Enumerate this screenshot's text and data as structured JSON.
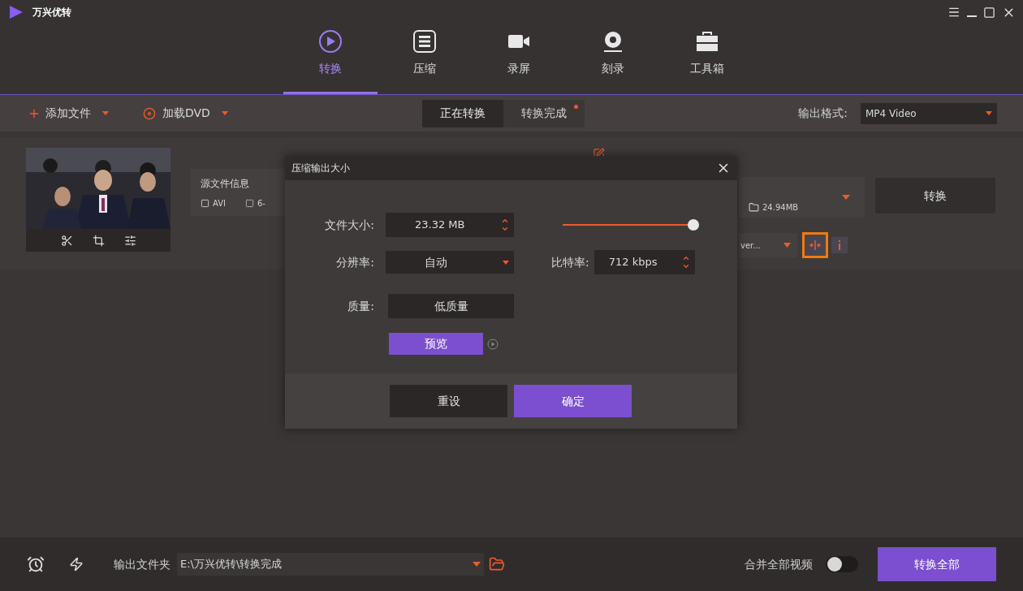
{
  "app": {
    "title": "万兴优转"
  },
  "nav_tabs": [
    {
      "label": "转换",
      "selected": true
    },
    {
      "label": "压缩",
      "selected": false
    },
    {
      "label": "录屏",
      "selected": false
    },
    {
      "label": "刻录",
      "selected": false
    },
    {
      "label": "工具箱",
      "selected": false
    }
  ],
  "toolbar": {
    "add_file": "添加文件",
    "load_dvd": "加载DVD",
    "status_tabs": [
      {
        "label": "正在转换",
        "selected": true,
        "notification": false
      },
      {
        "label": "转换完成",
        "selected": false,
        "notification": true
      }
    ],
    "output_format": {
      "label": "输出格式:",
      "value": "MP4 Video"
    }
  },
  "file": {
    "source_info_label": "源文件信息",
    "format": "AVI",
    "resolution": "6-",
    "target_size": "24.94MB",
    "preset": "ver...",
    "compress_highlighted": true,
    "convert": "转换"
  },
  "dialog": {
    "title": "压缩输出大小",
    "file_size": {
      "label": "文件大小:",
      "value": "23.32 MB"
    },
    "size_slider": {
      "level": 1.0
    },
    "resolution": {
      "label": "分辨率:",
      "value": "自动"
    },
    "bitrate": {
      "label": "比特率:",
      "value": "712 kbps"
    },
    "quality": {
      "label": "质量:",
      "value": "低质量"
    },
    "preview": "预览",
    "reset": "重设",
    "ok": "确定"
  },
  "footer": {
    "output_folder_label": "输出文件夹",
    "output_path": "E:\\万兴优转\\转换完成",
    "merge_label": "合并全部视频",
    "merge_on": false,
    "convert_all": "转换全部"
  }
}
